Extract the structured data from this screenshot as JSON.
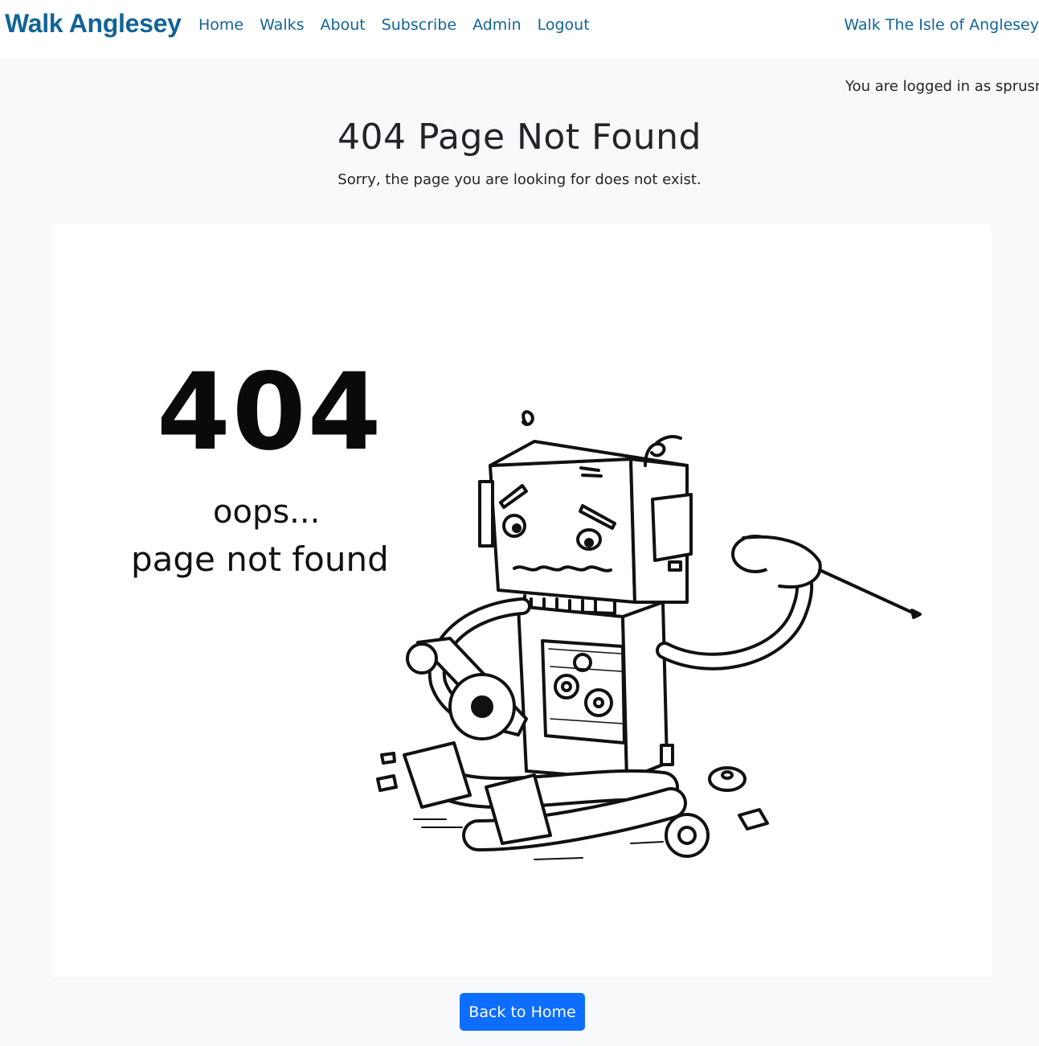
{
  "navbar": {
    "brand": "Walk Anglesey",
    "links": [
      "Home",
      "Walks",
      "About",
      "Subscribe",
      "Admin",
      "Logout"
    ],
    "right_text": "Walk The Isle of Anglesey"
  },
  "status": {
    "logged_in": "You are logged in as sprusr"
  },
  "main": {
    "title": "404 Page Not Found",
    "subtitle": "Sorry, the page you are looking for does not exist.",
    "illustration": {
      "big_text": "404",
      "line1": "oops...",
      "line2": "page not found"
    },
    "button_label": "Back to Home"
  },
  "colors": {
    "brand": "#126497",
    "button": "#0d6efd",
    "background": "#f8f9fa"
  }
}
